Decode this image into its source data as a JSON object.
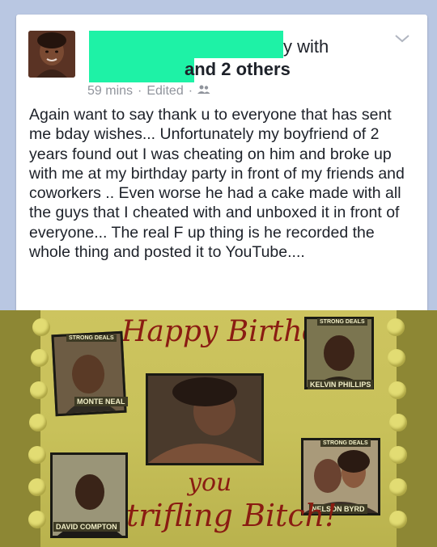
{
  "post": {
    "author_suffix": "y with",
    "others_text": "and 2 others",
    "time": "59 mins",
    "edited": "Edited",
    "separator": "·",
    "audience_icon": "friends-icon",
    "body": "Again want to say thank u to everyone that has sent me bday wishes... Unfortunately my boyfriend of 2 years found out I was cheating on him and broke up with me at my birthday party in front of my friends and coworkers .. Even worse he had a cake made with all the guys that I cheated with and unboxed it in front of everyone... The real F up thing is he recorded the whole thing and posted it to YouTube...."
  },
  "cake": {
    "header": "Happy Birthday",
    "footer_line1": "you",
    "footer_line2": "trifling Bitch!",
    "labels": {
      "top_left_top": "STRONG DEALS",
      "top_left_bottom": "MONTE NEAL",
      "top_right_top": "STRONG DEALS",
      "top_right_bottom": "KELVIN PHILLIPS",
      "mid_right_top": "STRONG DEALS",
      "bottom_left": "DAVID COMPTON",
      "bottom_right": "NELSON BYRD"
    }
  },
  "colors": {
    "redaction": "#1ef2a6",
    "background": "#b9c7e2",
    "icing": "#8a1c12"
  }
}
